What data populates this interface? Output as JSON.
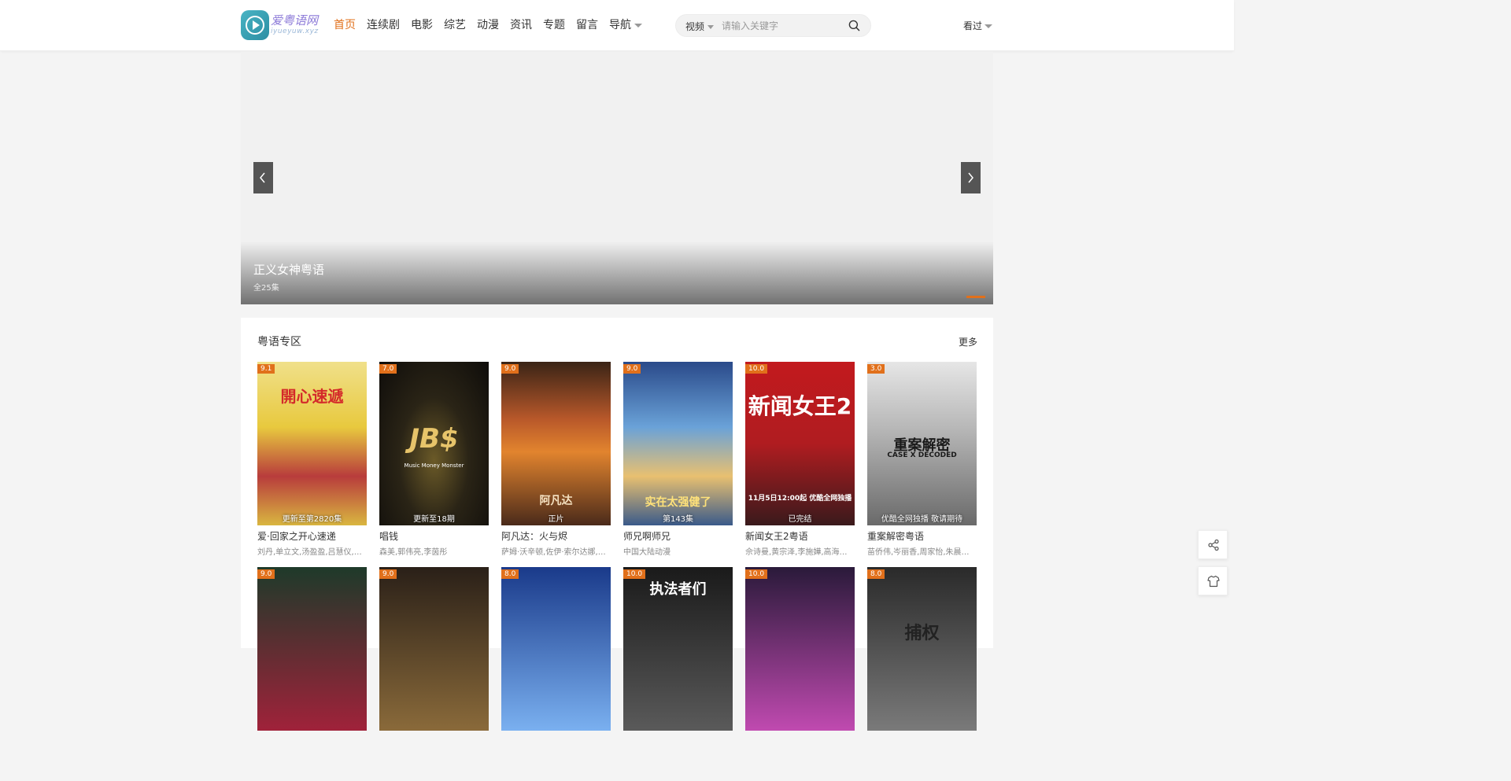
{
  "header": {
    "logo_text": "爱粤语网",
    "logo_sub": "iyueyuw.xyz",
    "nav": [
      {
        "label": "首页",
        "active": true
      },
      {
        "label": "连续剧"
      },
      {
        "label": "电影"
      },
      {
        "label": "综艺"
      },
      {
        "label": "动漫"
      },
      {
        "label": "资讯"
      },
      {
        "label": "专题"
      },
      {
        "label": "留言"
      },
      {
        "label": "导航",
        "dropdown": true
      }
    ],
    "search": {
      "type_label": "视频",
      "placeholder": "请输入关键字"
    },
    "history_label": "看过"
  },
  "banner": {
    "title": "正义女神粤语",
    "subtitle": "全25集"
  },
  "section": {
    "title": "粤语专区",
    "more_label": "更多",
    "items": [
      {
        "score": "9.1",
        "status": "更新至第2820集",
        "title": "爱·回家之开心速递",
        "actors": "刘丹,单立文,汤盈盈,吕慧仪,罗..."
      },
      {
        "score": "7.0",
        "status": "更新至18期",
        "title": "唱钱",
        "actors": "森美,郭伟亮,李茵彤"
      },
      {
        "score": "9.0",
        "status": "正片",
        "title": "阿凡达：火与烬",
        "actors": "萨姆·沃辛顿,佐伊·索尔达娜,西..."
      },
      {
        "score": "9.0",
        "status": "第143集",
        "title": "师兄啊师兄",
        "actors": "中国大陆动漫"
      },
      {
        "score": "10.0",
        "status": "已完结",
        "title": "新闻女王2粤语",
        "actors": "佘诗曼,黄宗泽,李施嬅,高海宁,..."
      },
      {
        "score": "3.0",
        "status": "优酷全网独播 敬请期待",
        "title": "重案解密粤语",
        "actors": "苗侨伟,岑丽香,周家怡,朱晨丽,..."
      },
      {
        "score": "9.0"
      },
      {
        "score": "9.0"
      },
      {
        "score": "8.0"
      },
      {
        "score": "10.0"
      },
      {
        "score": "10.0"
      },
      {
        "score": "8.0"
      }
    ]
  },
  "posters": {
    "p1_text": "開心速遞",
    "p2_text": "JB$",
    "p2_sub": "Music Money Monster",
    "p3_text": "阿凡达",
    "p4_text": "实在太强健了",
    "p5_text": "新闻女王2",
    "p5_note": "11月5日12:00起 优酷全网独播",
    "p6_text": "重案解密",
    "p6_sub": "CASE X DECODED",
    "p10_text": "执法者们",
    "p12_text": "捕权"
  },
  "colors": {
    "accent": "#e1701b"
  },
  "icons": [
    "search-icon",
    "chevron-left-icon",
    "chevron-right-icon",
    "share-icon",
    "shirt-icon"
  ]
}
